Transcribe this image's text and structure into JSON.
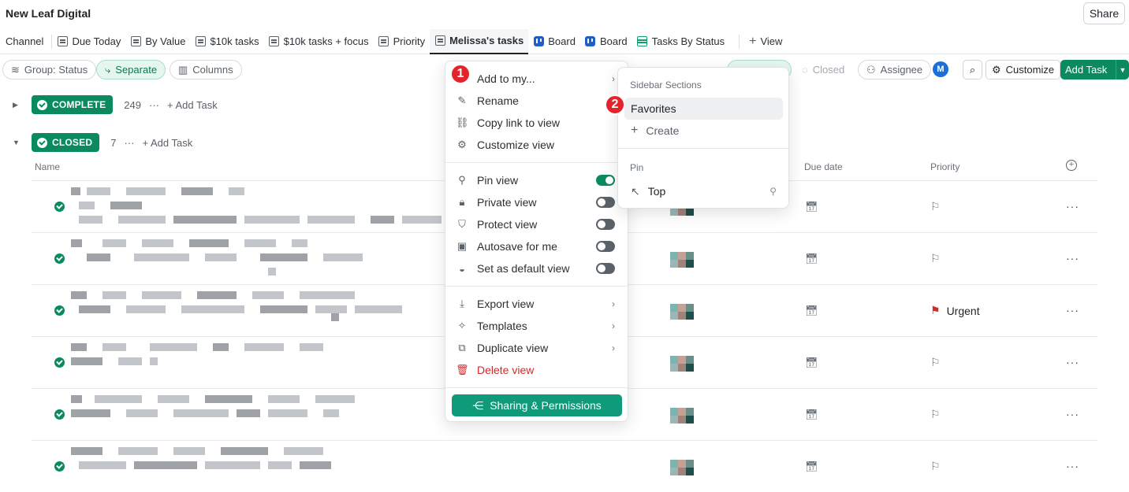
{
  "workspace": {
    "title": "New Leaf Digital",
    "share_label": "Share"
  },
  "views": [
    {
      "label": "Channel",
      "icon": "none"
    },
    {
      "label": "Due Today",
      "icon": "list-icon"
    },
    {
      "label": "By Value",
      "icon": "list-icon"
    },
    {
      "label": "$10k tasks",
      "icon": "list-icon"
    },
    {
      "label": "$10k tasks + focus",
      "icon": "list-icon"
    },
    {
      "label": "Priority",
      "icon": "list-icon"
    },
    {
      "label": "Melissa's tasks",
      "icon": "list-icon",
      "active": true
    },
    {
      "label": "Board",
      "icon": "board-icon"
    },
    {
      "label": "Board",
      "icon": "board-icon"
    },
    {
      "label": "Tasks By Status",
      "icon": "table-icon"
    },
    {
      "label": "View",
      "icon": "plus-icon"
    }
  ],
  "toolbar": {
    "group": "Group: Status",
    "separate": "Separate",
    "columns": "Columns",
    "closed": "Closed",
    "assignee": "Assignee",
    "avatar": "M",
    "customize": "Customize",
    "add_task": "Add Task"
  },
  "groups": {
    "complete": {
      "label": "COMPLETE",
      "count": "249",
      "add": "Add Task"
    },
    "closed": {
      "label": "CLOSED",
      "count": "7",
      "add": "Add Task"
    }
  },
  "columns": {
    "name": "Name",
    "due": "Due date",
    "priority": "Priority"
  },
  "rows": [
    {
      "priority": ""
    },
    {
      "priority": ""
    },
    {
      "priority": "Urgent"
    },
    {
      "priority": ""
    },
    {
      "priority": ""
    },
    {
      "priority": ""
    }
  ],
  "menu": {
    "add_to_my": "Add to my...",
    "rename": "Rename",
    "copy_link": "Copy link to view",
    "customize": "Customize view",
    "pin": "Pin view",
    "private": "Private view",
    "protect": "Protect view",
    "autosave": "Autosave for me",
    "default": "Set as default view",
    "export": "Export view",
    "templates": "Templates",
    "duplicate": "Duplicate view",
    "delete": "Delete view",
    "sharing": "Sharing & Permissions",
    "toggles": {
      "pin": true,
      "private": false,
      "protect": false,
      "autosave": false,
      "default": false
    }
  },
  "submenu": {
    "sections_header": "Sidebar Sections",
    "favorites": "Favorites",
    "create": "Create",
    "pin_header": "Pin",
    "top": "Top"
  },
  "markers": {
    "one": "1",
    "two": "2"
  },
  "colors": {
    "accent": "#0b8a5f",
    "urgent": "#d12a2a",
    "marker": "#e5232b"
  }
}
